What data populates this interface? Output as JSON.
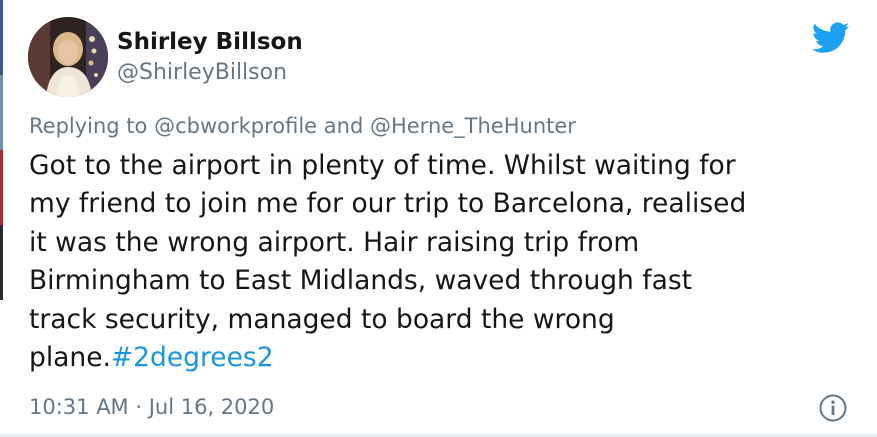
{
  "tweet": {
    "display_name": "Shirley Billson",
    "handle": "@ShirleyBillson",
    "reply_prefix": "Replying to ",
    "reply_mention_1": "@cbworkprofile",
    "reply_joiner": " and ",
    "reply_mention_2": "@Herne_TheHunter",
    "lines": [
      "Got to the airport in plenty of time. Whilst waiting for",
      "my friend to join me for our trip to Barcelona, realised",
      "it was the wrong airport. Hair raising trip from",
      "Birmingham to East Midlands, waved through fast",
      "track security, managed to board the wrong"
    ],
    "last_line_text": "plane.",
    "hashtag": "#2degrees2",
    "timestamp": "10:31 AM · Jul 16, 2020"
  },
  "icons": {
    "brand": "twitter-bird-icon",
    "info": "info-icon"
  },
  "colors": {
    "brand_blue": "#1da1f2",
    "text": "#14171a",
    "secondary": "#657786",
    "link": "#1b95e0"
  }
}
